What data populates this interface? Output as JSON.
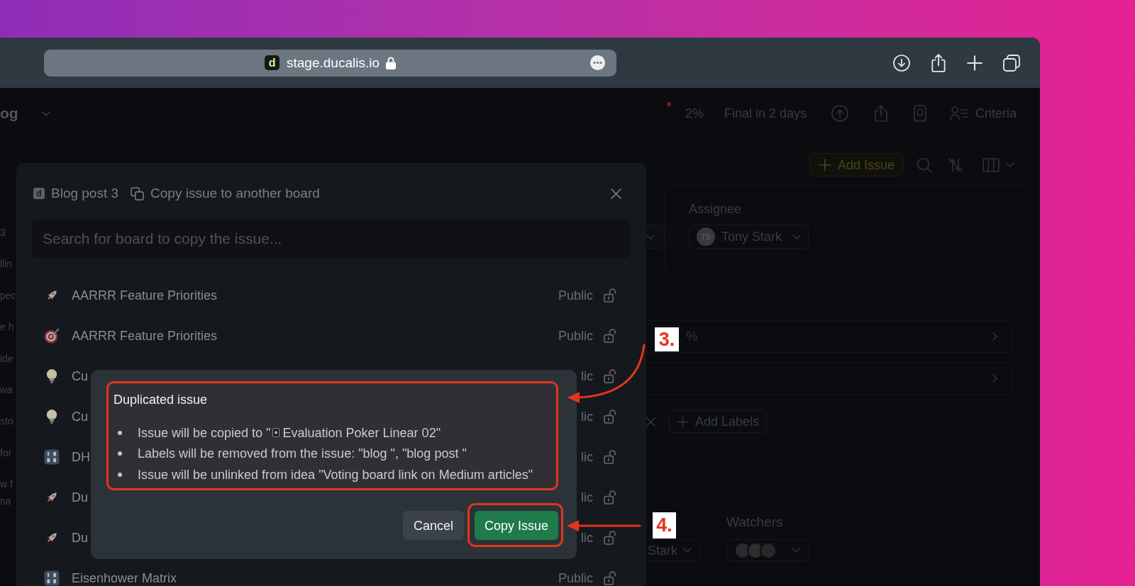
{
  "browser": {
    "favicon": "d",
    "address": "stage.ducalis.io"
  },
  "app": {
    "board_title": "og",
    "progress": "2%",
    "deadline": "Final in 2 days",
    "criteria_button": "Criteria",
    "add_issue_button": "Add Issue",
    "left_column": [
      "3",
      "llin",
      "pec",
      "e h",
      "ide",
      "wa",
      "sto",
      "for",
      "w f",
      "na"
    ],
    "assignee": {
      "label": "Assignee",
      "initials": "TS",
      "name": "Tony Stark"
    },
    "percent_field": {
      "value": "%"
    },
    "add_labels_button": "Add Labels",
    "owner_field": {
      "value": "Stark"
    },
    "watchers": {
      "label": "Watchers"
    }
  },
  "copy_modal": {
    "board_logo": "d",
    "board": "Blog post 3",
    "title": "Copy issue to another board",
    "search": {
      "placeholder": "Search for board to copy the issue..."
    },
    "boards": [
      {
        "kind": "rocket",
        "name": "AARRR Feature Priorities",
        "visibility": "Public"
      },
      {
        "kind": "target",
        "name": "AARRR Feature Priorities",
        "visibility": "Public"
      },
      {
        "kind": "bulb",
        "name": "Cu",
        "visibility": "lic"
      },
      {
        "kind": "bulb",
        "name": "Cu",
        "visibility": "lic"
      },
      {
        "kind": "tile",
        "name": "DH",
        "visibility": "lic"
      },
      {
        "kind": "rocket",
        "name": "Du",
        "visibility": "lic"
      },
      {
        "kind": "rocket",
        "name": "Du",
        "visibility": "lic"
      },
      {
        "kind": "tile",
        "name": "Eisenhower Matrix",
        "visibility": "Public"
      }
    ]
  },
  "confirm_dialog": {
    "title": "Duplicated issue",
    "notes": [
      {
        "kind": "board",
        "text": "Issue will be copied to \"",
        "board": "Evaluation Poker Linear 02\""
      },
      {
        "kind": "text",
        "text": "Labels will be removed from the issue: \"blog \", \"blog post \""
      },
      {
        "kind": "text",
        "text": "Issue will be unlinked from idea \"Voting board link on Medium articles\""
      }
    ],
    "buttons": [
      {
        "kind": "secondary",
        "label": "Cancel"
      },
      {
        "kind": "primary",
        "label": "Copy Issue"
      }
    ]
  },
  "annotations": [
    {
      "label": "3."
    },
    {
      "label": "4."
    }
  ]
}
